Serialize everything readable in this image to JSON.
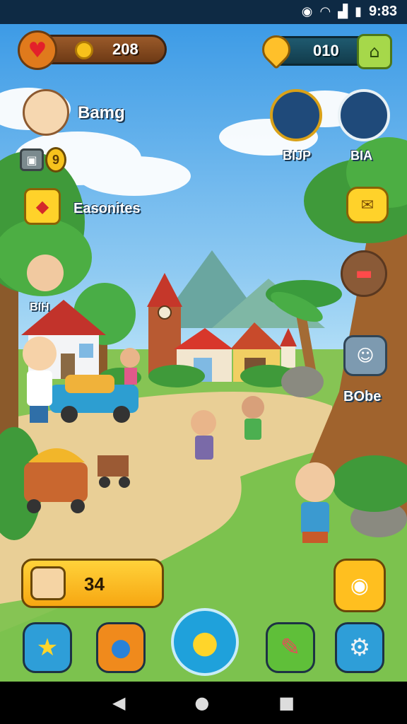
{
  "status_bar": {
    "time": "9:83",
    "icons": [
      "location-icon",
      "wifi-icon",
      "signal-icon",
      "battery-icon"
    ]
  },
  "hud": {
    "coins": "208",
    "gems": "010",
    "heart_icon": "heart-icon",
    "coin_icon": "coin-icon",
    "add_icon": "home-icon"
  },
  "player": {
    "name": "Bamg",
    "level": "9"
  },
  "left_menu": {
    "favorites_label": "Easonites"
  },
  "friends": [
    {
      "label": "BIJP"
    },
    {
      "label": "BIA"
    }
  ],
  "npcs": {
    "left_label": "BIH",
    "robot_label": "BObe"
  },
  "score_panel": {
    "value": "34"
  },
  "bottom_bar": {
    "buttons": [
      "star-icon",
      "balloon-icon",
      "chat-icon",
      "pen-icon",
      "gear-icon"
    ]
  },
  "nav": {
    "back": "◀",
    "home": "●",
    "recents": "■"
  },
  "colors": {
    "sky": "#3d9be6",
    "grass": "#7cc24e",
    "hud_brown": "#6e3a15",
    "accent_yellow": "#ffd22a"
  }
}
